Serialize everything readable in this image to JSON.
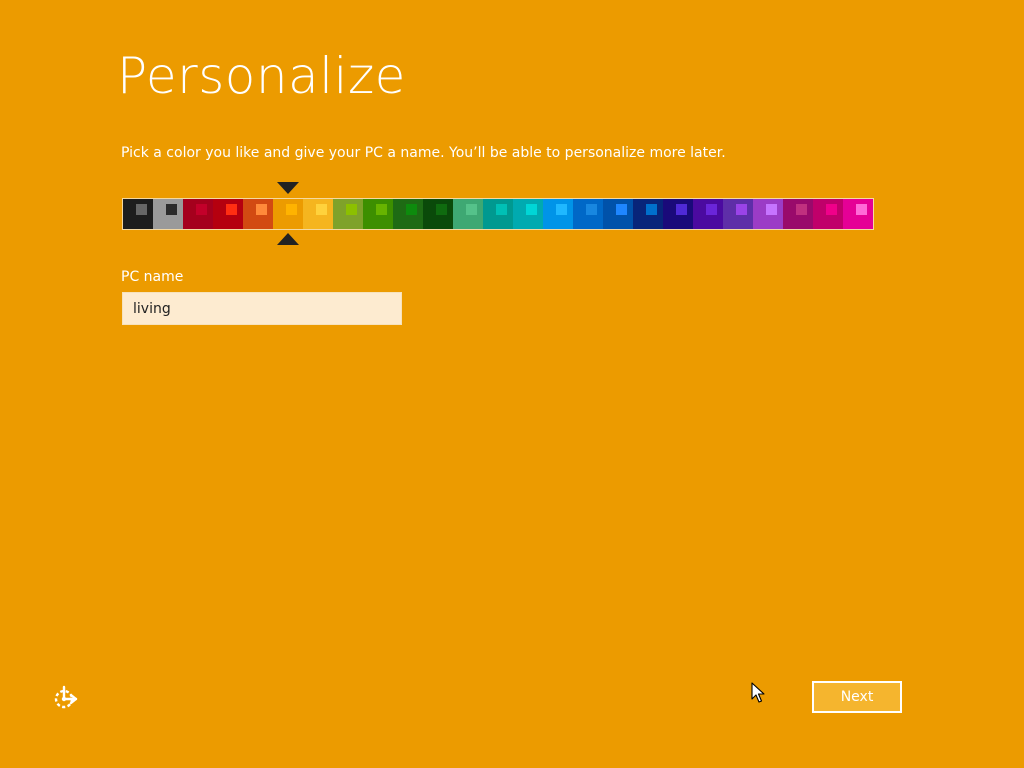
{
  "page": {
    "title": "Personalize",
    "subtitle": "Pick a color you like and give your PC a name. You’ll be able to personalize more later."
  },
  "palette": {
    "selected_index": 5,
    "swatches": [
      {
        "bg": "#1d1d1d",
        "accent": "#666666"
      },
      {
        "bg": "#9a9a9a",
        "accent": "#2b2b2b"
      },
      {
        "bg": "#a5001d",
        "accent": "#c3002a"
      },
      {
        "bg": "#b5000f",
        "accent": "#ff2e12"
      },
      {
        "bg": "#d24a12",
        "accent": "#ff8a3a"
      },
      {
        "bg": "#ec9b00",
        "accent": "#ffb300"
      },
      {
        "bg": "#f5b51f",
        "accent": "#ffd23c"
      },
      {
        "bg": "#7fa22a",
        "accent": "#8cc000"
      },
      {
        "bg": "#3d8f00",
        "accent": "#67b400"
      },
      {
        "bg": "#1e6b14",
        "accent": "#0d8b0d"
      },
      {
        "bg": "#0a4a0a",
        "accent": "#0f6b0f"
      },
      {
        "bg": "#3ea873",
        "accent": "#55c28a"
      },
      {
        "bg": "#009990",
        "accent": "#00c0b5"
      },
      {
        "bg": "#00aab0",
        "accent": "#00d6d6"
      },
      {
        "bg": "#0094e8",
        "accent": "#1fb8ff"
      },
      {
        "bg": "#0068c7",
        "accent": "#1887e0"
      },
      {
        "bg": "#0052aa",
        "accent": "#1e86ff"
      },
      {
        "bg": "#08257a",
        "accent": "#0070cc"
      },
      {
        "bg": "#1a0a7a",
        "accent": "#4f2ad6"
      },
      {
        "bg": "#4b0aa0",
        "accent": "#6a25d9"
      },
      {
        "bg": "#5e2ea8",
        "accent": "#9a43e8"
      },
      {
        "bg": "#9b3cc6",
        "accent": "#c674ff"
      },
      {
        "bg": "#990a6b",
        "accent": "#c0307f"
      },
      {
        "bg": "#c0006a",
        "accent": "#f0008a"
      },
      {
        "bg": "#e50096",
        "accent": "#ff6ad7"
      }
    ]
  },
  "pc_name": {
    "label": "PC name",
    "value": "living"
  },
  "footer": {
    "next_label": "Next",
    "ease_icon": "ease-of-access-icon",
    "cursor_icon": "mouse-pointer-icon"
  }
}
